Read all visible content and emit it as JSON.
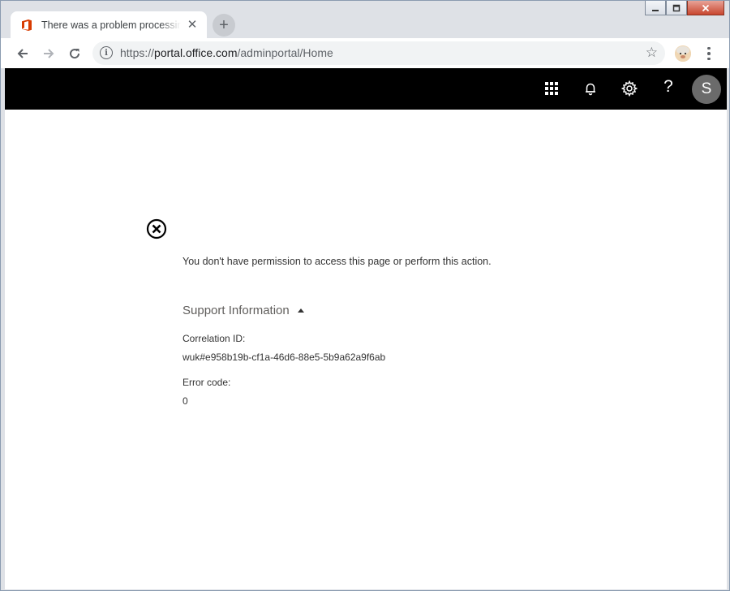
{
  "browser": {
    "tab": {
      "title": "There was a problem processing",
      "close_glyph": "✕"
    },
    "new_tab_glyph": "+",
    "window_controls": {
      "minimize": "–",
      "maximize": "□",
      "close": "✕"
    },
    "address": {
      "scheme": "https://",
      "host": "portal.office.com",
      "path": "/adminportal/Home"
    },
    "icons": [
      "back-arrow-icon",
      "forward-arrow-icon",
      "reload-icon",
      "info-icon",
      "star-icon",
      "profile-icon",
      "menu-dots-icon"
    ]
  },
  "suite_bar": {
    "help_glyph": "?",
    "avatar_initial": "S",
    "icons": [
      "app-launcher-icon",
      "bell-icon",
      "gear-icon",
      "help-icon"
    ]
  },
  "error_page": {
    "message": "You don't have permission to access this page or perform this action.",
    "support_header": "Support Information",
    "correlation_label": "Correlation ID:",
    "correlation_value": "wuk#e958b19b-cf1a-46d6-88e5-5b9a62a9f6ab",
    "error_code_label": "Error code:",
    "error_code_value": "0"
  },
  "colors": {
    "suite_bar": "#000000",
    "office_logo": "#d83b01",
    "avatar": "#6b6b6b"
  }
}
